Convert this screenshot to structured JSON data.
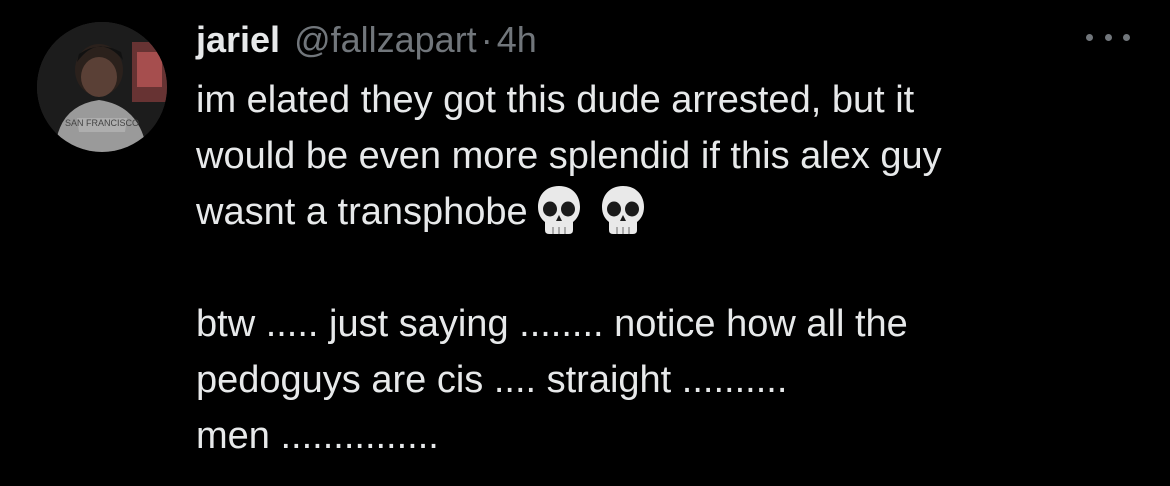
{
  "tweet": {
    "display_name": "jariel",
    "handle": "@fallzapart",
    "separator": "·",
    "time": "4h",
    "body_lines": [
      "im elated they got this dude arrested, but it",
      "would be even more splendid if this alex guy",
      "wasnt a transphobe",
      "",
      "btw ..... just saying ........ notice how all the",
      "pedoguys are cis .... straight ..........",
      "men ..............."
    ],
    "emojis": [
      "skull-emoji",
      "skull-emoji"
    ],
    "avatar_shirt_text": "SAN FRANCISCO"
  },
  "colors": {
    "background": "#000000",
    "text": "#e7e9ea",
    "secondary": "#71767b"
  }
}
